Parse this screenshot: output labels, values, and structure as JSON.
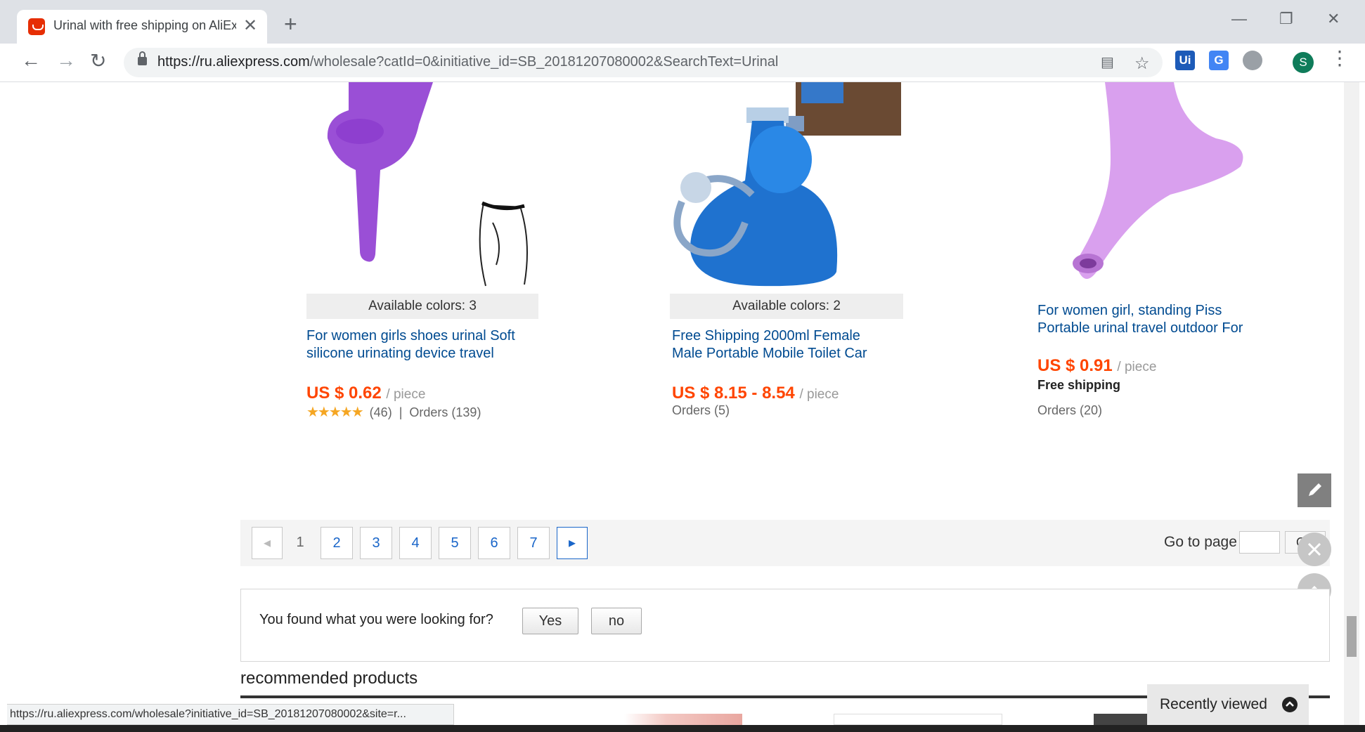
{
  "browser": {
    "tab_title": "Urinal with free shipping on AliEx",
    "tab_close": "✕",
    "new_tab": "+",
    "url_host": "https://ru.aliexpress.com",
    "url_path": "/wholesale?catId=0&initiative_id=SB_20181207080002&SearchText=Urinal",
    "avatar_letter": "S",
    "ext_ui_label": "Ui"
  },
  "products": [
    {
      "colors": "Available colors: 3",
      "title_line1": "For women girls shoes urinal Soft",
      "title_line2": "silicone urinating device travel",
      "price": "US $ 0.62",
      "unit": "/ piece",
      "stars": "★★★★★",
      "rating_count": "(46)",
      "separator": "|",
      "orders": "Orders (139)"
    },
    {
      "colors": "Available colors: 2",
      "title_line1": "Free Shipping 2000ml Female",
      "title_line2": "Male Portable Mobile Toilet Car",
      "price": "US $ 8.15 - 8.54",
      "unit": "/ piece",
      "orders": "Orders (5)"
    },
    {
      "title_line1": "For women girl, standing Piss",
      "title_line2": "Portable urinal travel outdoor For",
      "price": "US $ 0.91",
      "unit": "/ piece",
      "shipping": "Free shipping",
      "orders": "Orders (20)"
    }
  ],
  "pagination": {
    "pages": [
      "1",
      "2",
      "3",
      "4",
      "5",
      "6",
      "7"
    ],
    "current": "1",
    "goto_label": "Go to page",
    "ok_label": "OK"
  },
  "feedback": {
    "question": "You found what you were looking for?",
    "yes": "Yes",
    "no": "no"
  },
  "recommended_title": "recommended products",
  "status_url": "https://ru.aliexpress.com/wholesale?initiative_id=SB_20181207080002&site=r...",
  "recently_viewed": "Recently viewed",
  "colors": {
    "price": "#ff4500",
    "link": "#004b91",
    "page_link": "#1a66c9"
  }
}
